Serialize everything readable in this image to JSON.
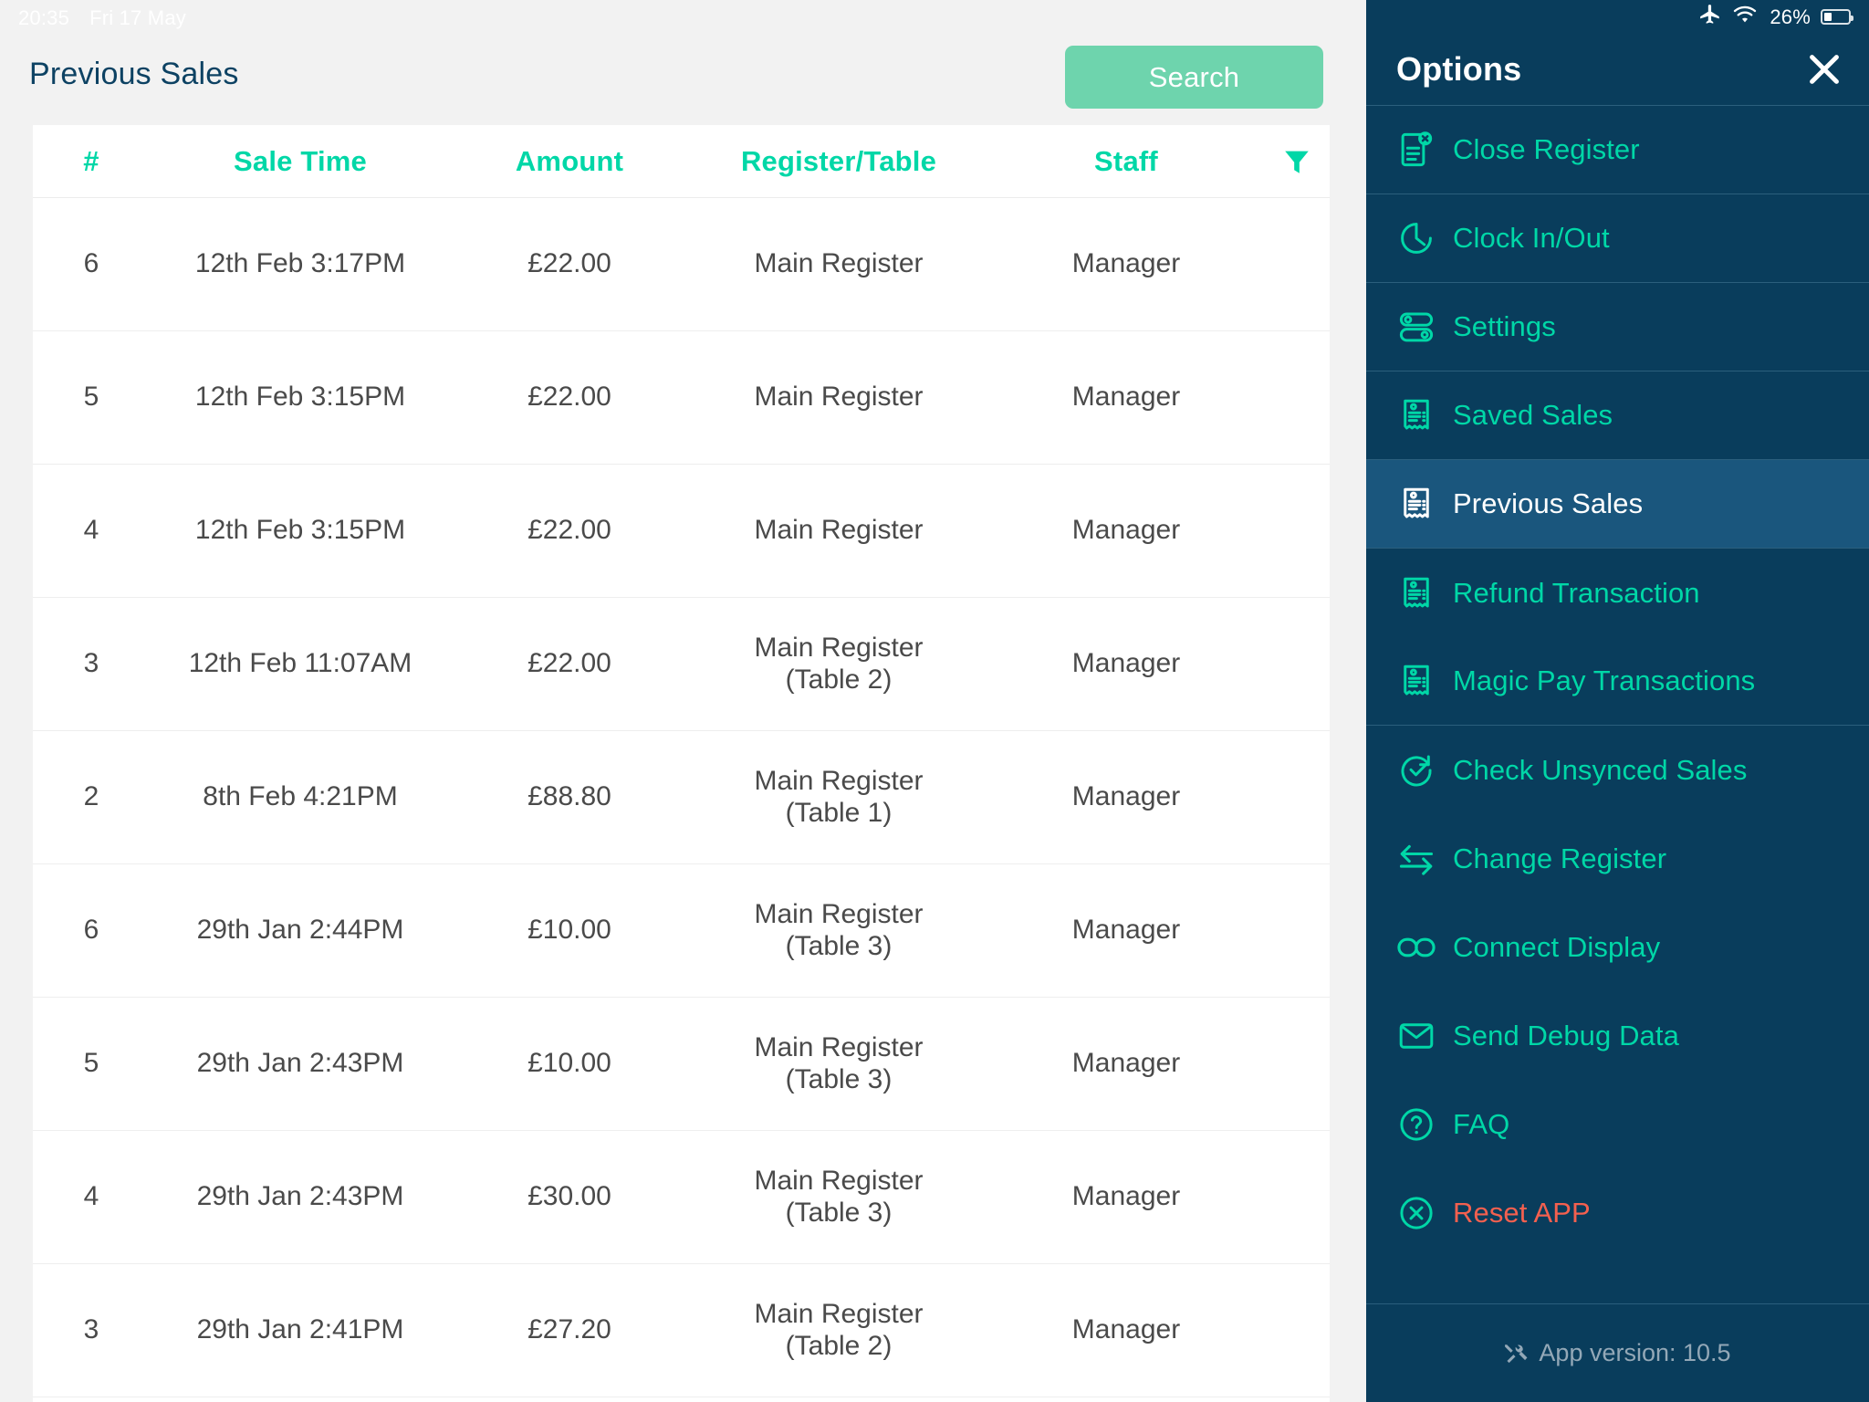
{
  "status_bar": {
    "time": "20:35",
    "date": "Fri 17 May",
    "airplane_icon": "airplane-icon",
    "wifi_icon": "wifi-icon",
    "battery_percent": "26%",
    "battery_icon": "battery-icon"
  },
  "header": {
    "title": "Previous Sales",
    "search_label": "Search"
  },
  "table": {
    "columns": [
      "#",
      "Sale Time",
      "Amount",
      "Register/Table",
      "Staff"
    ],
    "filter_icon": "filter-icon",
    "rows": [
      {
        "num": "6",
        "time": "12th Feb 3:17PM",
        "amount": "£22.00",
        "register": "Main Register",
        "table": "",
        "staff": "Manager"
      },
      {
        "num": "5",
        "time": "12th Feb 3:15PM",
        "amount": "£22.00",
        "register": "Main Register",
        "table": "",
        "staff": "Manager"
      },
      {
        "num": "4",
        "time": "12th Feb 3:15PM",
        "amount": "£22.00",
        "register": "Main Register",
        "table": "",
        "staff": "Manager"
      },
      {
        "num": "3",
        "time": "12th Feb 11:07AM",
        "amount": "£22.00",
        "register": "Main Register",
        "table": "(Table 2)",
        "staff": "Manager"
      },
      {
        "num": "2",
        "time": "8th Feb 4:21PM",
        "amount": "£88.80",
        "register": "Main Register",
        "table": "(Table 1)",
        "staff": "Manager"
      },
      {
        "num": "6",
        "time": "29th Jan 2:44PM",
        "amount": "£10.00",
        "register": "Main Register",
        "table": "(Table 3)",
        "staff": "Manager"
      },
      {
        "num": "5",
        "time": "29th Jan 2:43PM",
        "amount": "£10.00",
        "register": "Main Register",
        "table": "(Table 3)",
        "staff": "Manager"
      },
      {
        "num": "4",
        "time": "29th Jan 2:43PM",
        "amount": "£30.00",
        "register": "Main Register",
        "table": "(Table 3)",
        "staff": "Manager"
      },
      {
        "num": "3",
        "time": "29th Jan 2:41PM",
        "amount": "£27.20",
        "register": "Main Register",
        "table": "(Table 2)",
        "staff": "Manager"
      }
    ]
  },
  "options": {
    "title": "Options",
    "close_icon": "close-icon",
    "items": [
      {
        "label": "Close Register",
        "icon": "document-close-icon",
        "active": false,
        "divider": true,
        "danger": false
      },
      {
        "label": "Clock In/Out",
        "icon": "clock-icon",
        "active": false,
        "divider": true,
        "danger": false
      },
      {
        "label": "Settings",
        "icon": "toggle-icon",
        "active": false,
        "divider": true,
        "danger": false
      },
      {
        "label": "Saved Sales",
        "icon": "receipt-icon",
        "active": false,
        "divider": true,
        "danger": false
      },
      {
        "label": "Previous Sales",
        "icon": "receipt-icon",
        "active": true,
        "divider": true,
        "danger": false
      },
      {
        "label": "Refund Transaction",
        "icon": "receipt-icon",
        "active": false,
        "divider": false,
        "danger": false
      },
      {
        "label": "Magic Pay Transactions",
        "icon": "receipt-icon",
        "active": false,
        "divider": true,
        "danger": false
      },
      {
        "label": "Check Unsynced Sales",
        "icon": "sync-check-icon",
        "active": false,
        "divider": false,
        "danger": false
      },
      {
        "label": "Change Register",
        "icon": "swap-arrows-icon",
        "active": false,
        "divider": false,
        "danger": false
      },
      {
        "label": "Connect Display",
        "icon": "link-icon",
        "active": false,
        "divider": false,
        "danger": false
      },
      {
        "label": "Send Debug Data",
        "icon": "envelope-icon",
        "active": false,
        "divider": false,
        "danger": false
      },
      {
        "label": "FAQ",
        "icon": "question-circle-icon",
        "active": false,
        "divider": false,
        "danger": false
      },
      {
        "label": "Reset APP",
        "icon": "x-circle-icon",
        "active": false,
        "divider": false,
        "danger": true
      }
    ],
    "version_text": "App version: 10.5",
    "version_icon": "tools-icon"
  },
  "colors": {
    "panel_bg": "#093d5c",
    "accent_teal": "#00d7a7",
    "active_row": "#1a567d",
    "search_green": "#6ed4ad",
    "danger_red": "#f4604f",
    "title_navy": "#0d4263"
  }
}
